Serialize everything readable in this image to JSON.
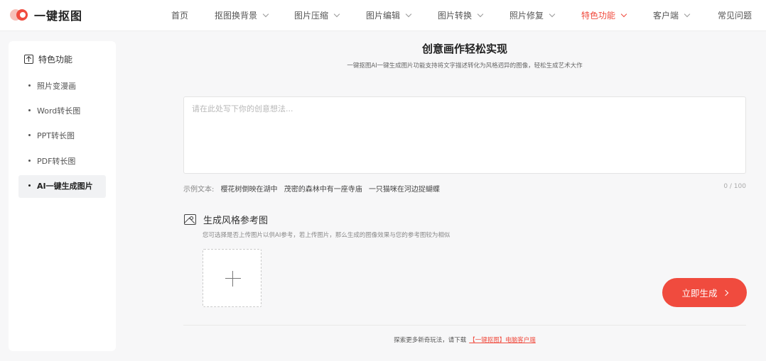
{
  "brand": {
    "name": "一键抠图"
  },
  "nav": {
    "items": [
      {
        "label": "首页"
      },
      {
        "label": "抠图换背景"
      },
      {
        "label": "图片压缩"
      },
      {
        "label": "图片编辑"
      },
      {
        "label": "图片转换"
      },
      {
        "label": "照片修复"
      },
      {
        "label": "特色功能"
      },
      {
        "label": "客户端"
      },
      {
        "label": "常见问题"
      }
    ],
    "active": "特色功能",
    "accent_color": "#f04b3e"
  },
  "sidebar": {
    "title": "特色功能",
    "items": [
      {
        "label": "照片变漫画"
      },
      {
        "label": "Word转长图"
      },
      {
        "label": "PPT转长图"
      },
      {
        "label": "PDF转长图"
      },
      {
        "label": "AI一键生成图片"
      }
    ],
    "active": "AI一键生成图片"
  },
  "main": {
    "title": "创意画作轻松实现",
    "subtitle": "一键抠图AI一键生成图片功能支持将文字描述转化为风格迥异的图像，轻松生成艺术大作",
    "prompt": {
      "value": "",
      "placeholder": "请在此处写下你的创意想法..."
    },
    "examples": {
      "label": "示例文本:",
      "items": [
        "樱花树倒映在湖中",
        "茂密的森林中有一座寺庙",
        "一只猫咪在河边捉蝴蝶"
      ]
    },
    "counter": "0 / 100",
    "style_ref": {
      "title": "生成风格参考图",
      "desc": "您可选择是否上传图片以供AI参考，若上传图片，那么生成的图像效果与您的参考图较为相似"
    },
    "generate_label": "立即生成",
    "footer": {
      "text": "探索更多新奇玩法，请下载",
      "link": "【一键抠图】电脑客户端"
    }
  }
}
